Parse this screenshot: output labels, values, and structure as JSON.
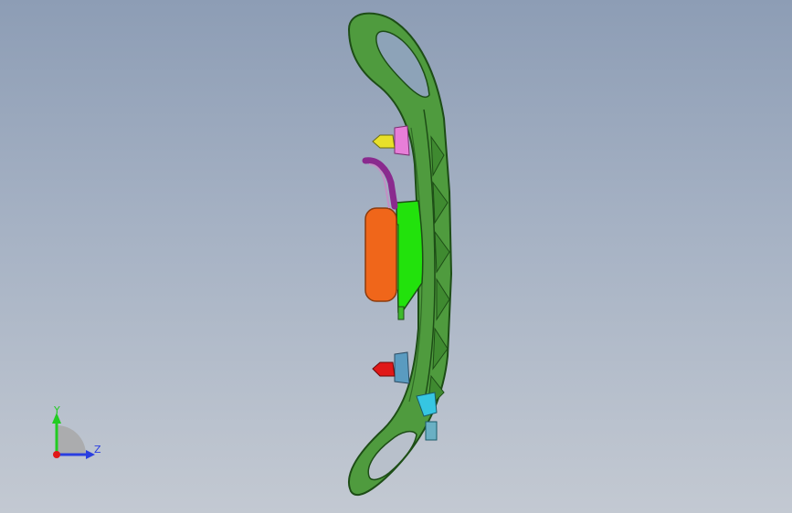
{
  "viewport": {
    "background_top": "#8d9db5",
    "background_bottom": "#c3c9d2"
  },
  "model_colors": {
    "frame_green": "#4f9b3e",
    "frame_edge": "#1d4d16",
    "bracket_bright_green": "#22e20c",
    "cushion_orange": "#f0661a",
    "cable_purple": "#8a2a8e",
    "nut_yellow": "#e8e02a",
    "washer_pink": "#e77ed8",
    "nut_red": "#e01818",
    "washer_blue": "#5a9bc0",
    "clip_cyan": "#36c6e2"
  },
  "triad": {
    "y_label": "Y",
    "z_label": "Z",
    "y_color": "#22cc22",
    "z_color": "#2a3ee0",
    "x_color": "#e01818"
  }
}
